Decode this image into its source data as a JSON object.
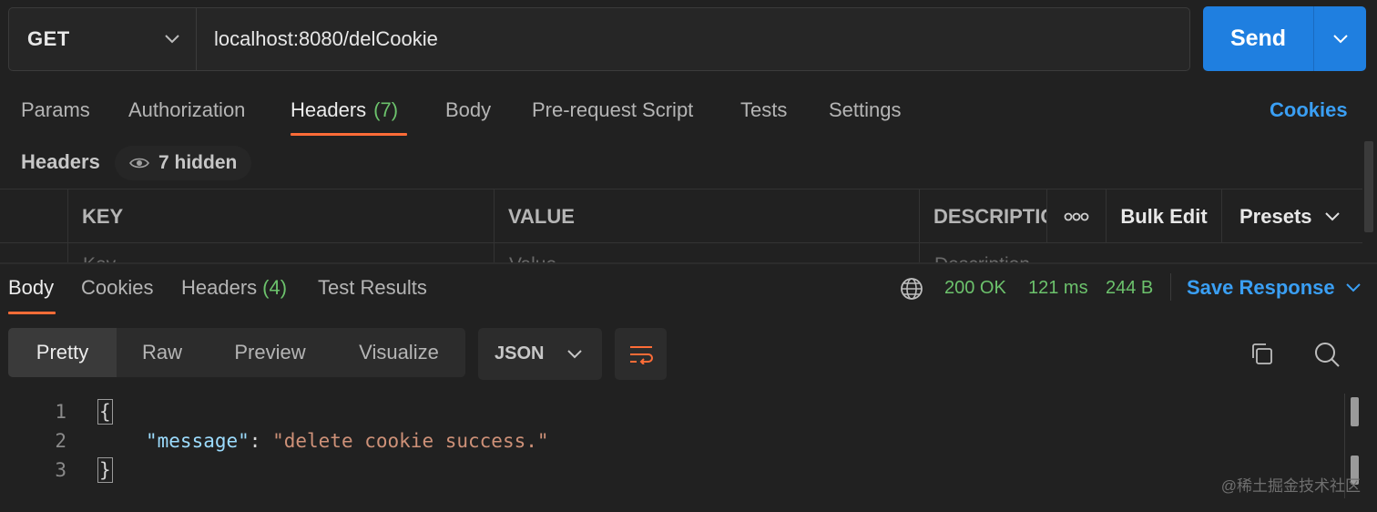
{
  "request": {
    "method": "GET",
    "url": "localhost:8080/delCookie",
    "send_label": "Send"
  },
  "request_tabs": {
    "params": "Params",
    "authorization": "Authorization",
    "headers": "Headers",
    "headers_count": "(7)",
    "body": "Body",
    "prerequest": "Pre-request Script",
    "tests": "Tests",
    "settings": "Settings",
    "cookies": "Cookies"
  },
  "headers_section": {
    "title": "Headers",
    "hidden_label": "7 hidden",
    "columns": {
      "key": "KEY",
      "value": "VALUE",
      "description": "DESCRIPTIC",
      "more": "ooo",
      "bulk_edit": "Bulk Edit",
      "presets": "Presets"
    },
    "placeholders": {
      "key": "Key",
      "value": "Value",
      "description": "Description"
    }
  },
  "response_tabs": {
    "body": "Body",
    "cookies": "Cookies",
    "headers": "Headers",
    "headers_count": "(4)",
    "test_results": "Test Results"
  },
  "response_status": {
    "status": "200 OK",
    "time": "121 ms",
    "size": "244 B",
    "save_label": "Save Response",
    "color": "#6cc26c"
  },
  "view_modes": [
    "Pretty",
    "Raw",
    "Preview",
    "Visualize"
  ],
  "format": "JSON",
  "code": {
    "line_numbers": [
      "1",
      "2",
      "3"
    ],
    "open_brace": "{",
    "key": "\"message\"",
    "colon": ": ",
    "value": "\"delete cookie success.\"",
    "close_brace": "}"
  },
  "watermark": "@稀土掘金技术社区",
  "colors": {
    "accent_orange": "#ff6c37",
    "link_blue": "#3a9ff4",
    "send_blue": "#1f7fe0",
    "success_green": "#6cc26c",
    "background": "#212121"
  }
}
